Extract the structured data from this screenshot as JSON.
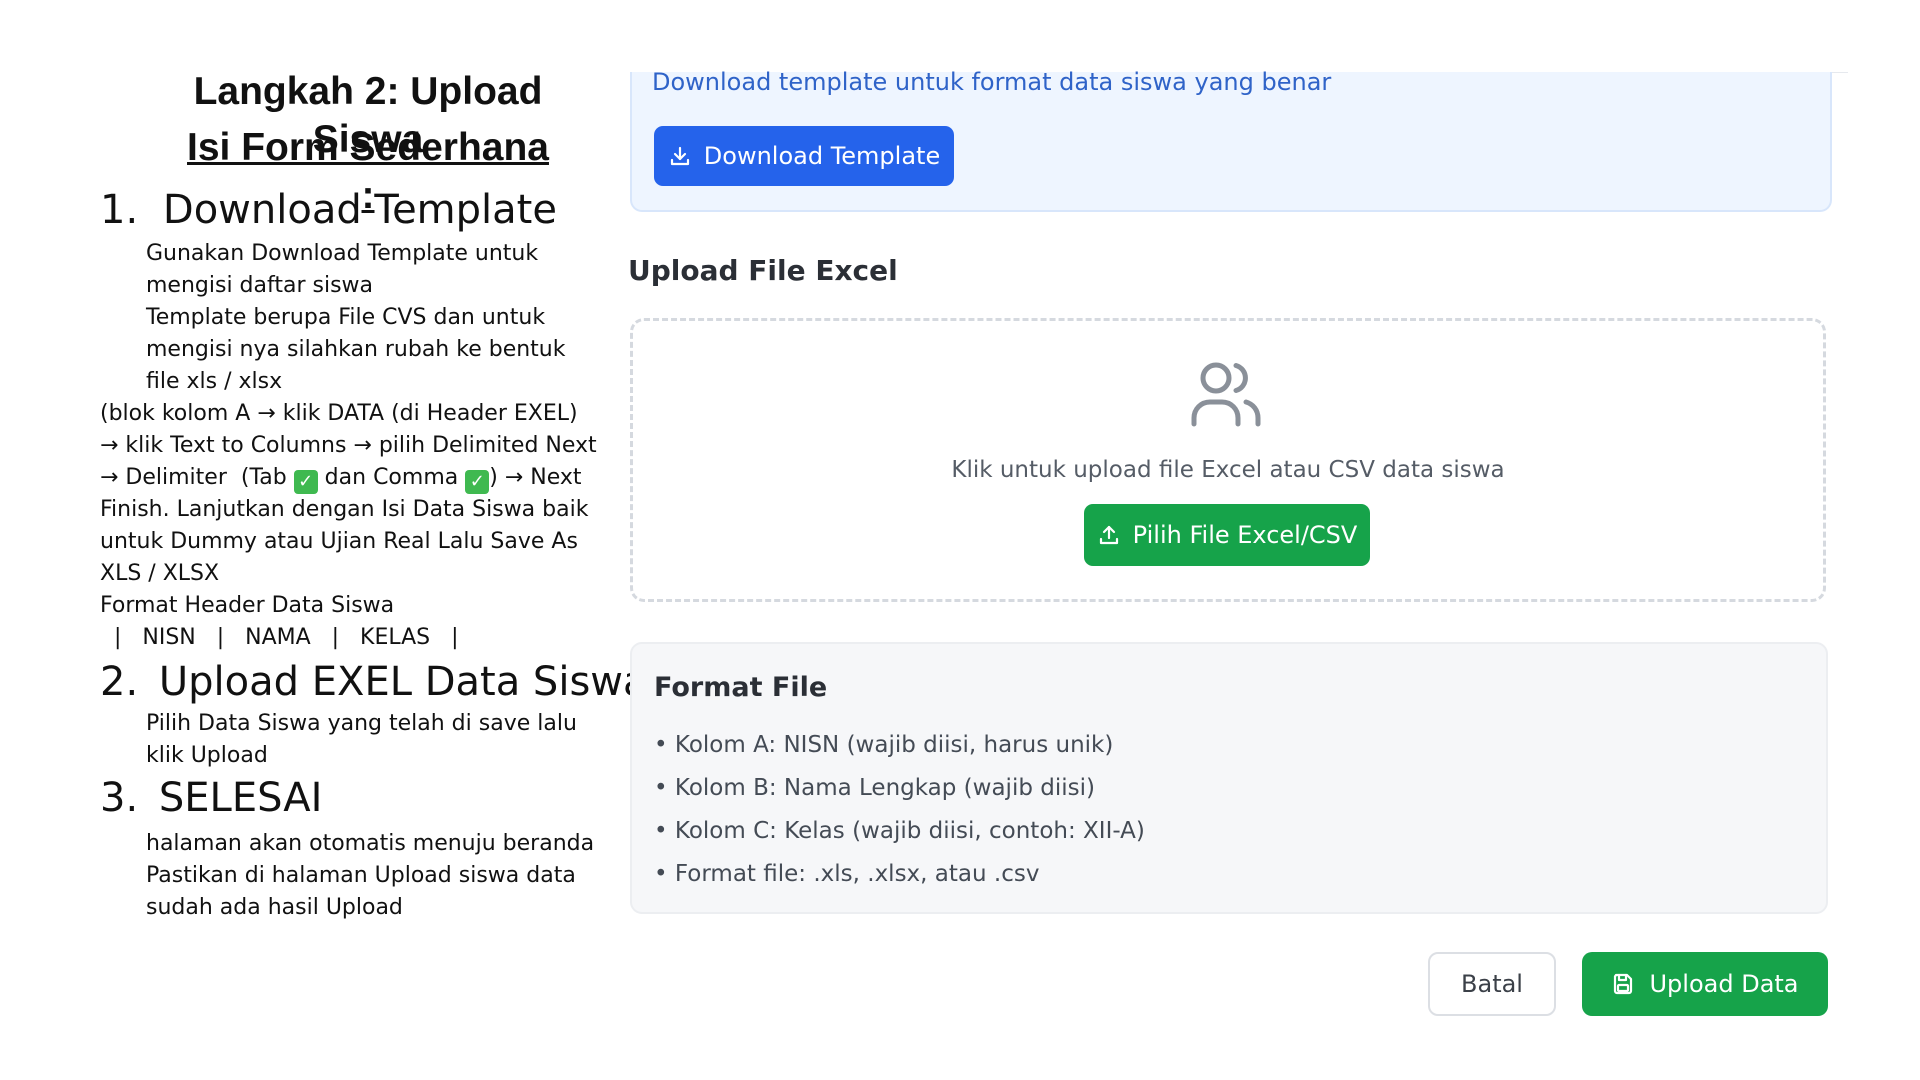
{
  "tutorial": {
    "title": "Langkah 2: Upload Siswa",
    "subtitle": "Isi Form Sederhana :",
    "step1": {
      "number": "1.",
      "heading": "Download Template",
      "indented_lines": [
        "Gunakan Download Template untuk",
        "mengisi daftar siswa",
        "Template berupa File CVS dan untuk",
        "mengisi nya silahkan rubah ke bentuk",
        "file xls / xlsx"
      ],
      "line_a": "(blok kolom A → klik DATA (di Header EXEL)",
      "line_b": "→ klik Text to Columns → pilih Delimited Next",
      "line_c_part1": "→ Delimiter  (Tab ",
      "line_c_part2": " dan Comma ",
      "line_c_part3": ") → Next",
      "checkmark": "✓",
      "line_d": "Finish. Lanjutkan dengan Isi Data Siswa baik",
      "line_e": "untuk Dummy atau Ujian Real Lalu Save As",
      "line_f": "XLS / XLSX",
      "line_g": "Format Header Data Siswa",
      "line_h": "  |   NISN   |   NAMA   |   KELAS   |"
    },
    "step2": {
      "number": "2.",
      "heading": "Upload EXEL Data Siswa",
      "lines": [
        "Pilih Data Siswa yang telah di save lalu",
        "klik Upload"
      ]
    },
    "step3": {
      "number": "3.",
      "heading": "SELESAI",
      "lines": [
        "halaman akan otomatis menuju beranda",
        "Pastikan di halaman Upload siswa data",
        "sudah ada hasil Upload"
      ]
    }
  },
  "panel": {
    "info_text": "Download template untuk format data siswa yang benar",
    "download_button": "Download Template",
    "upload_section_title": "Upload File Excel",
    "dropzone_text": "Klik untuk upload file Excel atau CSV data siswa",
    "choose_file_button": "Pilih File Excel/CSV",
    "format_title": "Format File",
    "format_items": [
      "Kolom A: NISN (wajib diisi, harus unik)",
      "Kolom B: Nama Lengkap (wajib diisi)",
      "Kolom C: Kelas (wajib diisi, contoh: XII-A)",
      "Format file: .xls, .xlsx, atau .csv"
    ],
    "cancel_button": "Batal",
    "upload_button": "Upload Data"
  },
  "colors": {
    "primary_blue": "#2563eb",
    "success_green": "#16a34a",
    "info_bg": "#eef5ff",
    "info_text": "#2f63c8"
  },
  "icons": [
    "download-icon",
    "users-icon",
    "upload-icon",
    "save-icon",
    "checkmark-icon"
  ]
}
